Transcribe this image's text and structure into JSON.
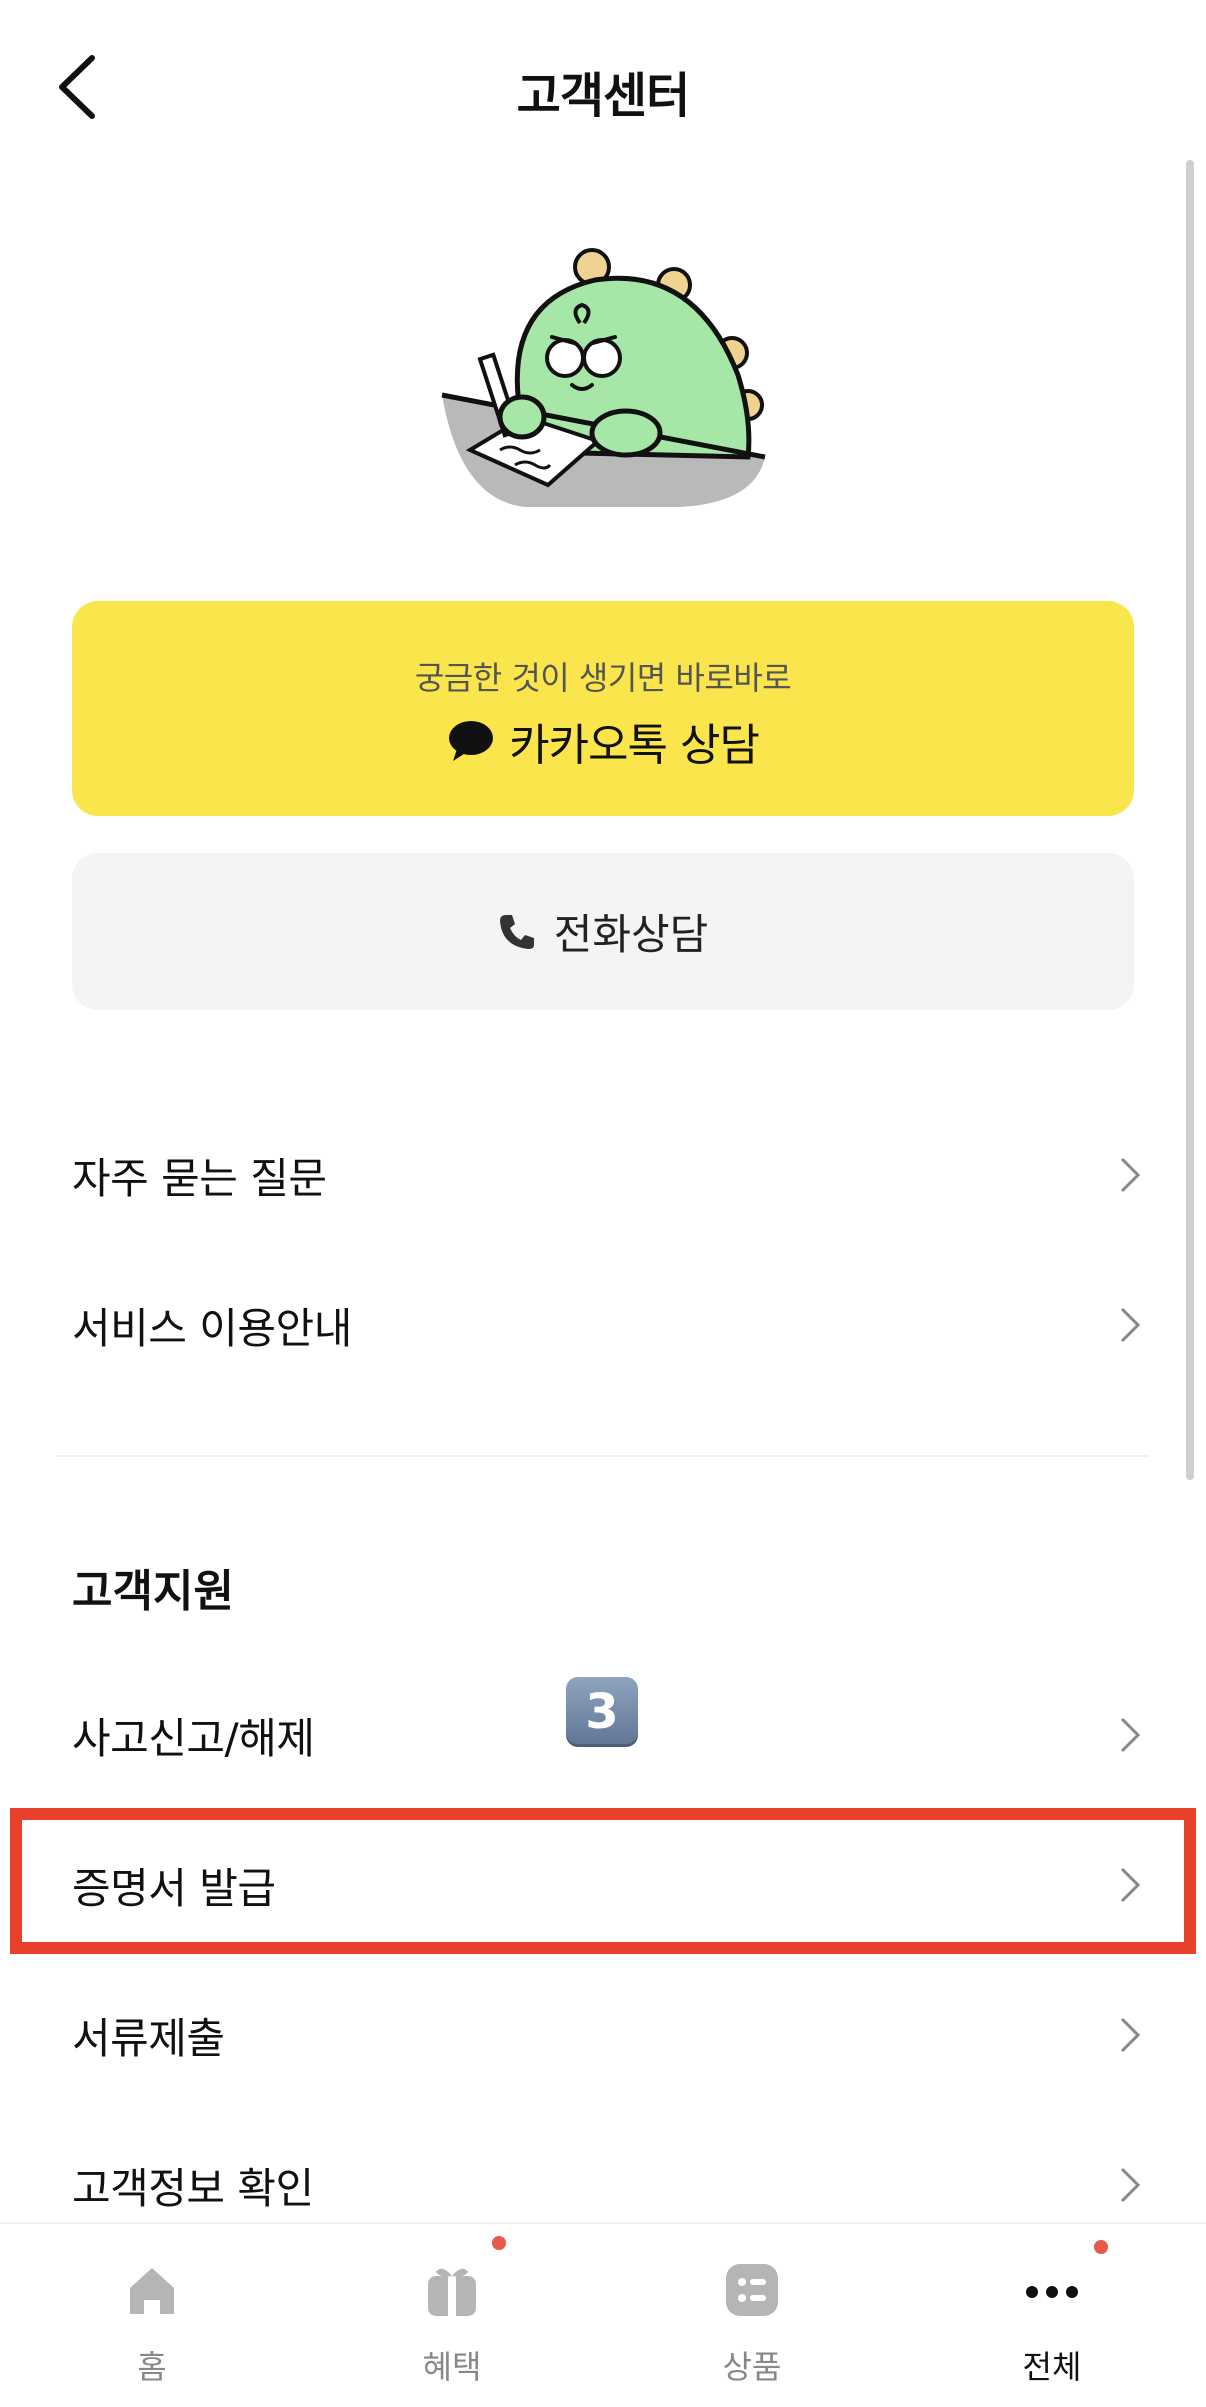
{
  "header": {
    "title": "고객센터",
    "back_icon": "chevron-left-icon"
  },
  "mascot": {
    "icon": "writing-dinosaur-illustration"
  },
  "consult": {
    "kakao_subtitle": "궁금한 것이 생기면 바로바로",
    "kakao_label": "카카오톡 상담",
    "phone_label": "전화상담",
    "kakao_color": "#fae64c",
    "phone_bg": "#f4f4f4"
  },
  "links": [
    {
      "label": "자주 묻는 질문"
    },
    {
      "label": "서비스 이용안내"
    }
  ],
  "support": {
    "title": "고객지원",
    "items": [
      {
        "label": "사고신고/해제"
      },
      {
        "label": "증명서 발급"
      },
      {
        "label": "서류제출"
      },
      {
        "label": "고객정보 확인"
      }
    ]
  },
  "annotation": {
    "step_number": "3",
    "highlight_color": "#e8412b"
  },
  "bottom_nav": {
    "items": [
      {
        "label": "홈",
        "icon": "home-icon"
      },
      {
        "label": "혜택",
        "icon": "gift-icon"
      },
      {
        "label": "상품",
        "icon": "product-list-icon"
      },
      {
        "label": "전체",
        "icon": "more-dots-icon"
      }
    ],
    "badge_color": "#e55a4b"
  }
}
